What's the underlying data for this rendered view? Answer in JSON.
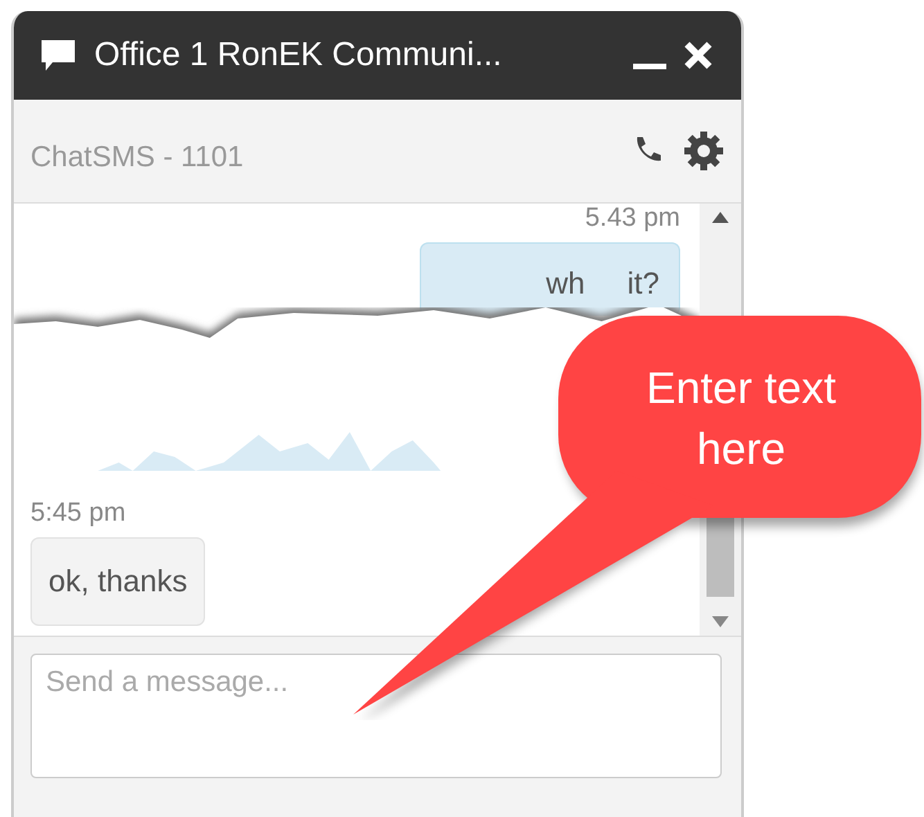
{
  "window": {
    "title": "Office 1 RonEK Communi..."
  },
  "header": {
    "label": "ChatSMS - 1101"
  },
  "messages": [
    {
      "time": "5.43 pm",
      "text": "wh     it?",
      "outgoing": true,
      "torn": true
    },
    {
      "time": "5:45 pm",
      "text": "ok, thanks",
      "outgoing": false,
      "torn": false
    }
  ],
  "composer": {
    "placeholder": "Send a message..."
  },
  "callout": {
    "text": "Enter text here"
  }
}
